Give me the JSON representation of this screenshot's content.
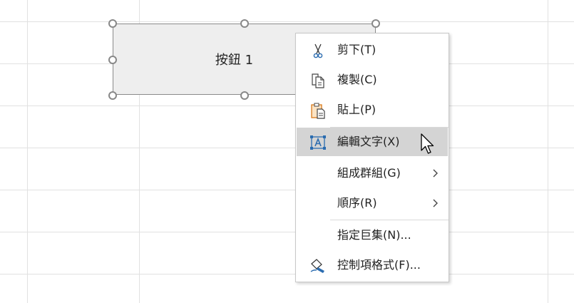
{
  "form_button": {
    "label": "按鈕 1"
  },
  "context_menu": {
    "items": [
      {
        "label": "剪下(T)",
        "icon": "scissors-icon",
        "has_submenu": false
      },
      {
        "label": "複製(C)",
        "icon": "copy-icon",
        "has_submenu": false
      },
      {
        "label": "貼上(P)",
        "icon": "paste-icon",
        "has_submenu": false
      },
      {
        "label": "編輯文字(X)",
        "icon": "edit-text-icon",
        "has_submenu": false,
        "highlighted": true
      },
      {
        "label": "組成群組(G)",
        "icon": null,
        "has_submenu": true
      },
      {
        "label": "順序(R)",
        "icon": null,
        "has_submenu": true
      },
      {
        "label": "指定巨集(N)...",
        "icon": null,
        "has_submenu": false
      },
      {
        "label": "控制項格式(F)...",
        "icon": "format-control-icon",
        "has_submenu": false
      }
    ]
  },
  "colors": {
    "highlight": "#d4d4d4",
    "icon_blue": "#2b6cb0",
    "icon_orange": "#d97a1a",
    "gridline": "#e1e1e1"
  }
}
